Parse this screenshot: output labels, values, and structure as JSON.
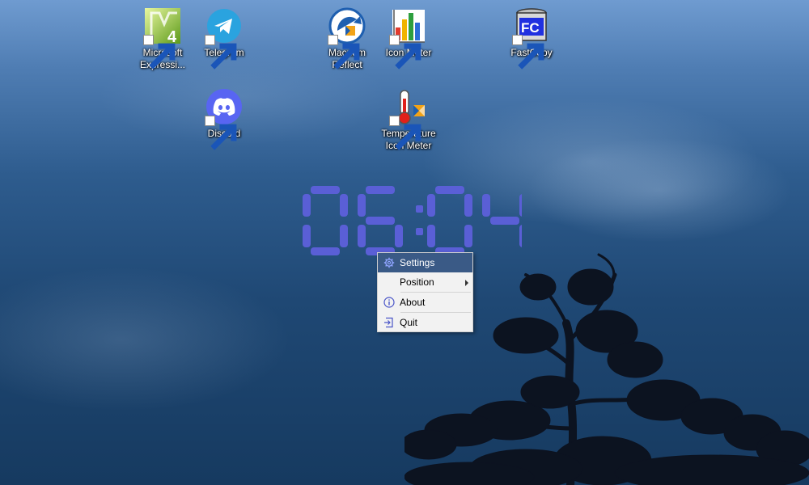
{
  "desktop_icons": [
    {
      "label": "Microsoft Expressi...",
      "icon": "microsoft-expression-icon"
    },
    {
      "label": "Telegram",
      "icon": "telegram-icon"
    },
    {
      "label": "Macrium Reflect",
      "icon": "macrium-reflect-icon"
    },
    {
      "label": "Icon Meter",
      "icon": "icon-meter-icon"
    },
    {
      "label": "FastCopy",
      "icon": "fastcopy-icon"
    },
    {
      "label": "Discord",
      "icon": "discord-icon"
    },
    {
      "label": "Temperature Icon Meter",
      "icon": "temperature-icon-meter-icon"
    }
  ],
  "clock": {
    "time": "06:04",
    "color": "#5a5fd6"
  },
  "context_menu": {
    "items": [
      {
        "label": "Settings",
        "icon": "gear-icon",
        "highlighted": true
      },
      {
        "label": "Position",
        "submenu": true
      },
      {
        "label": "About",
        "icon": "info-icon"
      },
      {
        "label": "Quit",
        "icon": "exit-icon"
      }
    ]
  },
  "colors": {
    "menu_highlight": "#3a5a86",
    "icon_accent": "#4a55c8"
  }
}
